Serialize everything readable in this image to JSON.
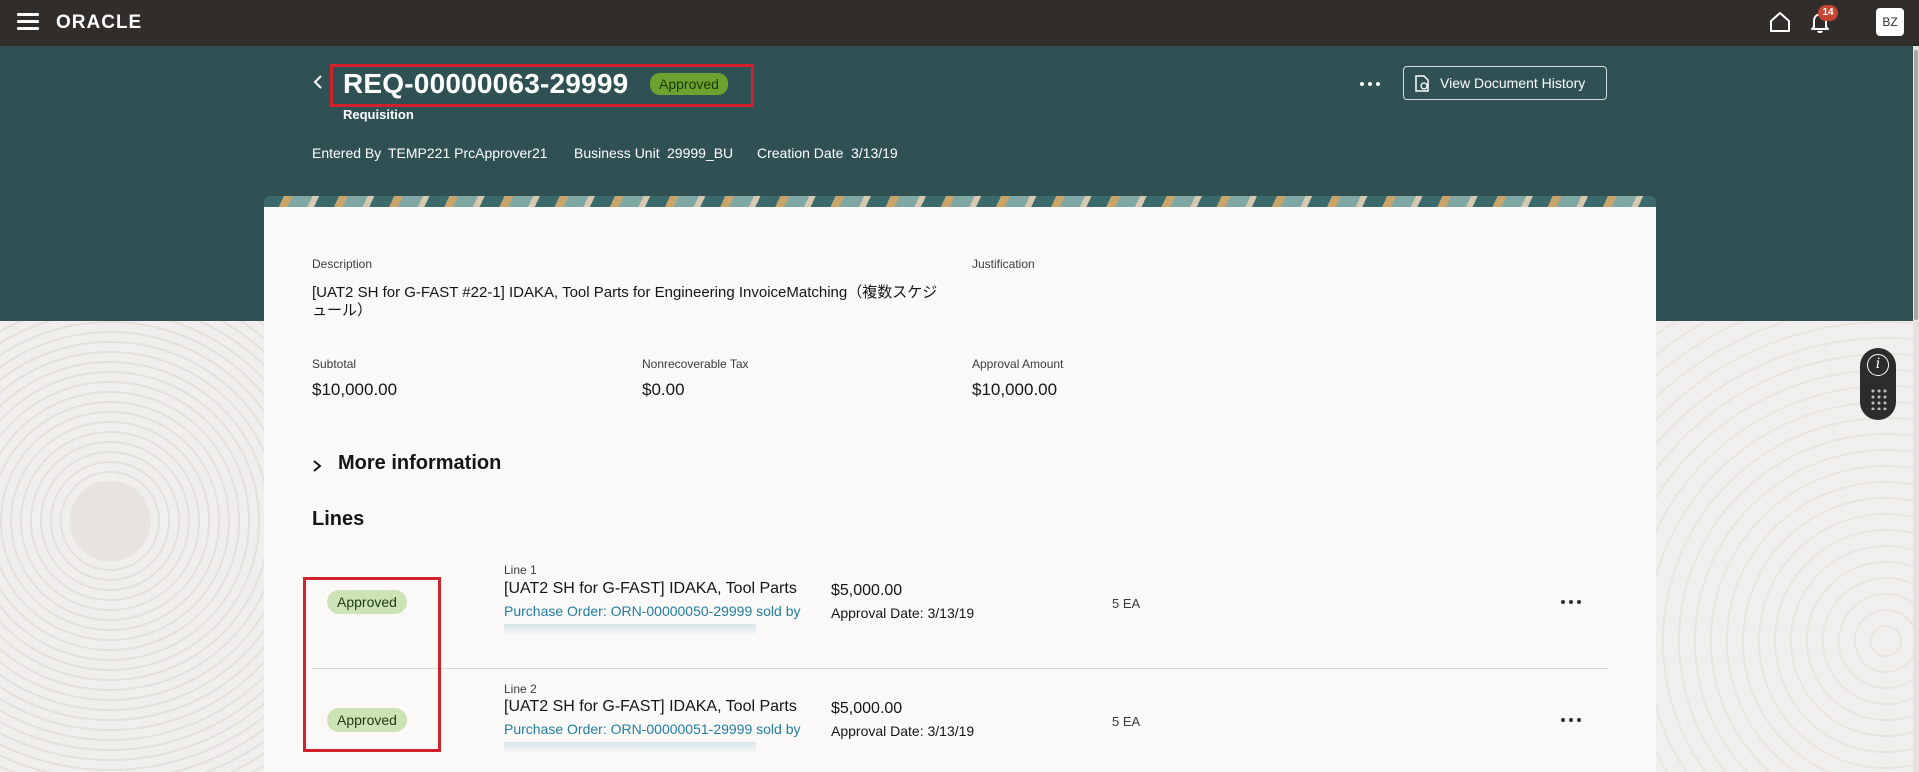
{
  "header": {
    "logo": "ORACLE",
    "notification_count": "14",
    "avatar_initials": "BZ"
  },
  "requisition": {
    "number": "REQ-00000063-29999",
    "status": "Approved",
    "type": "Requisition",
    "entered_by_label": "Entered By",
    "entered_by": "TEMP221 PrcApprover21",
    "business_unit_label": "Business Unit",
    "business_unit": "29999_BU",
    "creation_date_label": "Creation Date",
    "creation_date": "3/13/19",
    "view_history_label": "View Document History"
  },
  "details": {
    "description_label": "Description",
    "description": "[UAT2 SH for G-FAST #22-1] IDAKA, Tool Parts for Engineering InvoiceMatching（複数スケジュール）",
    "justification_label": "Justification",
    "subtotal_label": "Subtotal",
    "subtotal": "$10,000.00",
    "tax_label": "Nonrecoverable Tax",
    "tax": "$0.00",
    "approval_amount_label": "Approval Amount",
    "approval_amount": "$10,000.00",
    "more_info_label": "More information"
  },
  "lines": {
    "heading": "Lines",
    "items": [
      {
        "status": "Approved",
        "line_label": "Line 1",
        "title": "[UAT2 SH for G-FAST] IDAKA, Tool Parts",
        "po": "Purchase Order: ORN-00000050-29999 sold by",
        "amount": "$5,000.00",
        "approval_date": "Approval Date: 3/13/19",
        "qty": "5 EA"
      },
      {
        "status": "Approved",
        "line_label": "Line 2",
        "title": "[UAT2 SH for G-FAST] IDAKA, Tool Parts",
        "po": "Purchase Order: ORN-00000051-29999 sold by",
        "amount": "$5,000.00",
        "approval_date": "Approval Date: 3/13/19",
        "qty": "5 EA"
      }
    ]
  },
  "colors": {
    "header_bg": "#312d2a",
    "hero_bg": "#2f5154",
    "status_green": "#6ea230",
    "link_blue": "#227e9e",
    "highlight_red": "#d1222b"
  }
}
